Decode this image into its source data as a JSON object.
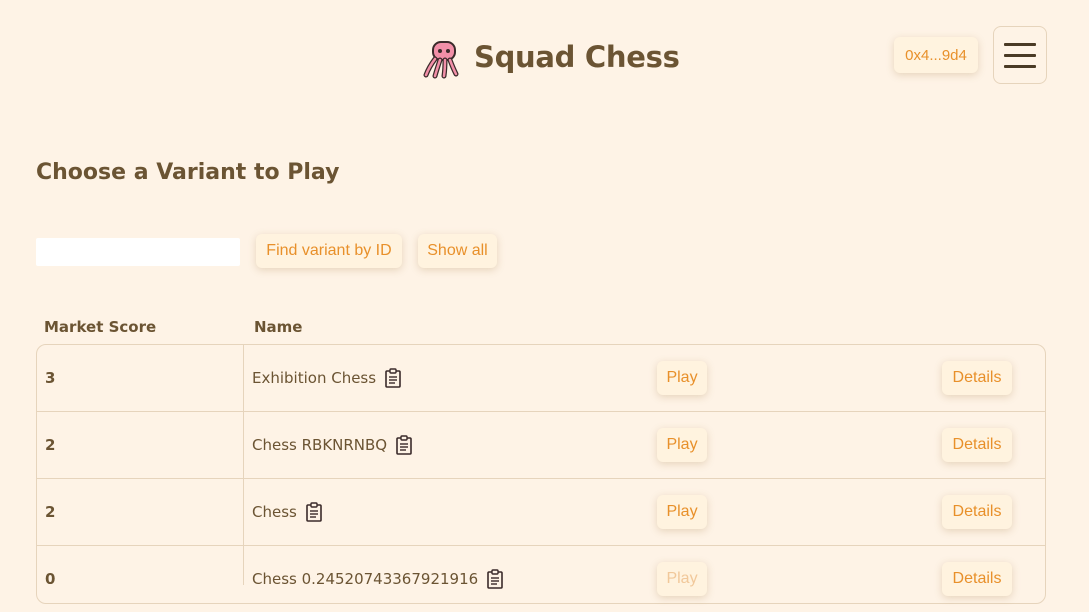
{
  "header": {
    "title": "Squad Chess",
    "wallet": "0x4...9d4"
  },
  "main": {
    "section_title": "Choose a Variant to Play",
    "search": {
      "value": "",
      "placeholder": ""
    },
    "find_button": "Find variant by ID",
    "show_all_button": "Show all",
    "table": {
      "columns": [
        "Market Score",
        "Name"
      ],
      "rows": [
        {
          "score": "3",
          "name": "Exhibition Chess",
          "play": "Play",
          "details": "Details"
        },
        {
          "score": "2",
          "name": "Chess RBKNRNBQ",
          "play": "Play",
          "details": "Details"
        },
        {
          "score": "2",
          "name": "Chess",
          "play": "Play",
          "details": "Details"
        },
        {
          "score": "0",
          "name": "Chess 0.24520743367921916",
          "play": "Play",
          "details": "Details"
        }
      ]
    }
  },
  "colors": {
    "background": "#fef3e6",
    "accent": "#e8902a",
    "text": "#6b5433"
  },
  "icons": [
    "squid-logo-icon",
    "menu-icon",
    "clipboard-icon"
  ]
}
